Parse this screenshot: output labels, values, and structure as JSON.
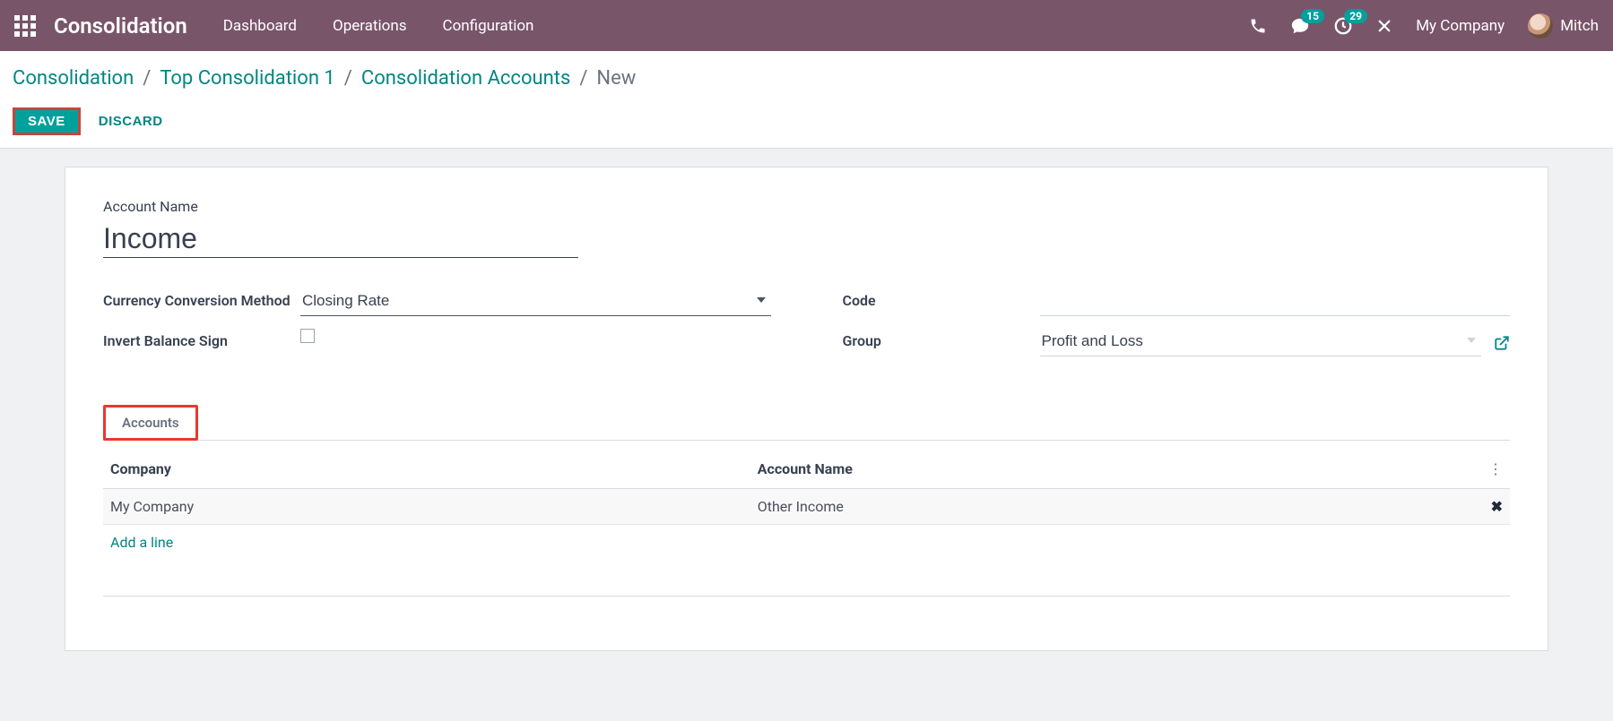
{
  "topbar": {
    "app_title": "Consolidation",
    "nav": {
      "dashboard": "Dashboard",
      "operations": "Operations",
      "configuration": "Configuration"
    },
    "badges": {
      "messages": "15",
      "activities": "29"
    },
    "company": "My Company",
    "user_name": "Mitch"
  },
  "breadcrumb": {
    "items": [
      "Consolidation",
      "Top Consolidation 1",
      "Consolidation Accounts"
    ],
    "current": "New"
  },
  "actions": {
    "save": "SAVE",
    "discard": "DISCARD"
  },
  "form": {
    "account_name_label": "Account Name",
    "account_name_value": "Income",
    "currency_method_label": "Currency Conversion Method",
    "currency_method_value": "Closing Rate",
    "invert_label": "Invert Balance Sign",
    "invert_value": false,
    "code_label": "Code",
    "code_value": "",
    "group_label": "Group",
    "group_value": "Profit and Loss"
  },
  "tabs": {
    "accounts": "Accounts"
  },
  "table": {
    "headers": {
      "company": "Company",
      "account_name": "Account Name"
    },
    "rows": [
      {
        "company": "My Company",
        "account_name": "Other Income"
      }
    ],
    "add_line": "Add a line"
  }
}
